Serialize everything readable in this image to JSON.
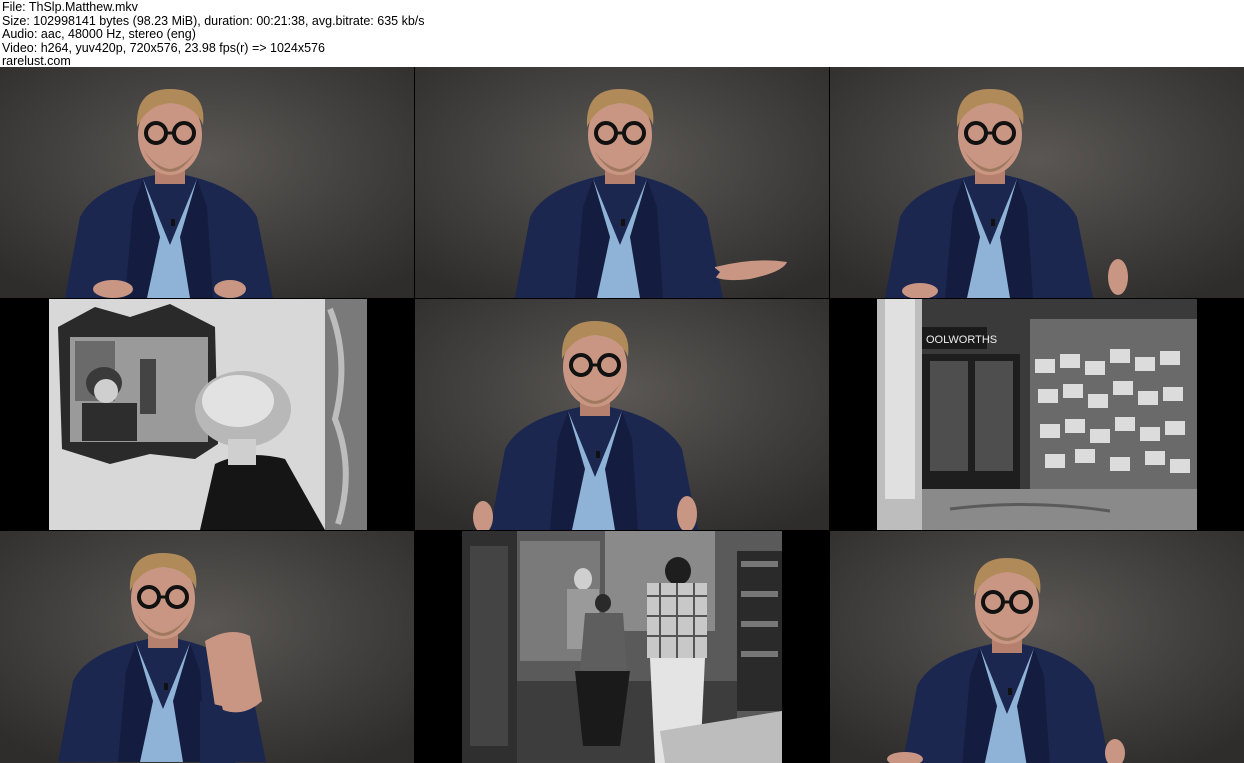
{
  "header": {
    "file_line": "File: ThSlp.Matthew.mkv",
    "size_line": "Size: 102998141 bytes (98.23 MiB), duration: 00:21:38, avg.bitrate: 635 kb/s",
    "audio_line": "Audio: aac, 48000 Hz, stereo (eng)",
    "video_line": "Video: h264, yuv420p, 720x576, 23.98 fps(r) => 1024x576",
    "site_line": "rarelust.com"
  },
  "thumbnails": {
    "shop_sign_text": "OOLWORTHS",
    "colors": {
      "studio_bg": "#4a4846",
      "jacket": "#1c2750",
      "shirt": "#8fb3d6",
      "skin": "#c99683",
      "hair": "#b18a5a",
      "letterbox": "#000000"
    }
  }
}
